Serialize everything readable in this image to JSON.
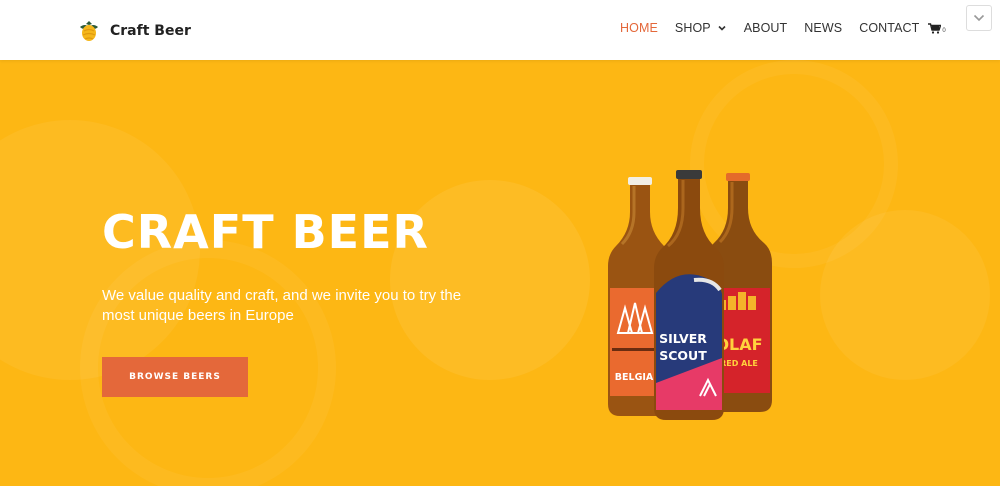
{
  "header": {
    "brand": "Craft Beer",
    "logo_icon": "hop-icon",
    "nav": {
      "home": "HOME",
      "shop": "SHOP",
      "about": "ABOUT",
      "news": "NEWS",
      "contact": "CONTACT"
    },
    "cart_count": "0",
    "active_nav": "HOME"
  },
  "hero": {
    "title": "CRAFT BEER",
    "subtitle": "We value quality and craft, and we invite you to try the most unique beers in Europe",
    "button": "BROWSE BEERS"
  },
  "bottles": {
    "left_label": "BELGIAN",
    "center_label_line1": "SILVER",
    "center_label_line2": "SCOUT",
    "right_label_line1": "OLAF",
    "right_label_line2": "RED ALE"
  },
  "colors": {
    "accent": "#e4683a",
    "hero_bg": "#fdb714",
    "text_dark": "#333333"
  }
}
